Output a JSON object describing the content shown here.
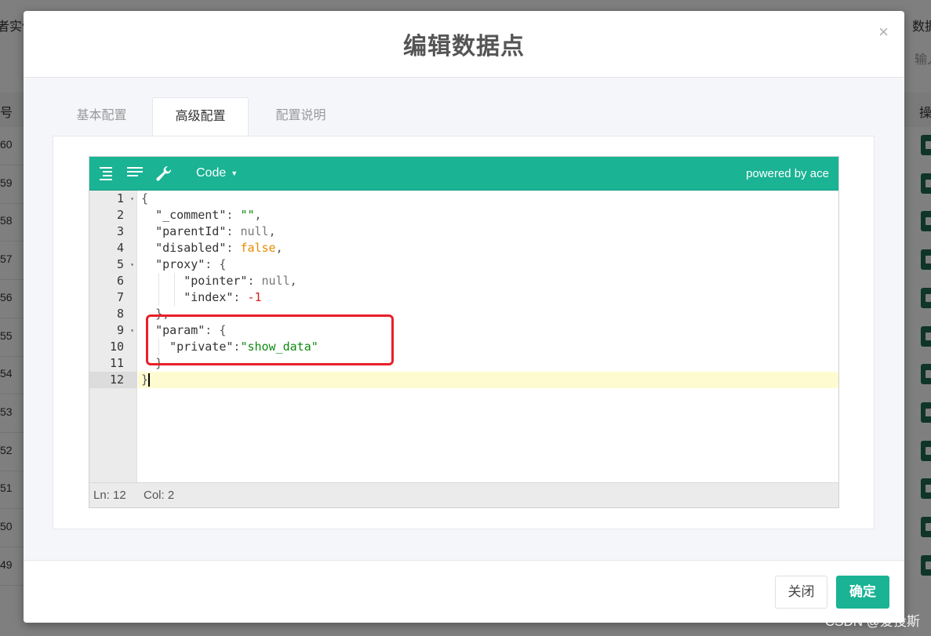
{
  "background": {
    "header_left": "者实例",
    "header_right": "数据",
    "input_right": "输入",
    "col_left": "号",
    "col_right": "操",
    "row_ids": [
      "60",
      "59",
      "58",
      "57",
      "56",
      "55",
      "54",
      "53",
      "52",
      "51",
      "50",
      "49"
    ]
  },
  "modal": {
    "title": "编辑数据点",
    "close_glyph": "×",
    "tabs": [
      {
        "label": "基本配置"
      },
      {
        "label": "高级配置"
      },
      {
        "label": "配置说明"
      }
    ],
    "active_tab": "高级配置",
    "editor": {
      "mode_label": "Code",
      "powered_by": "powered by ace",
      "line_numbers": [
        "1",
        "2",
        "3",
        "4",
        "5",
        "6",
        "7",
        "8",
        "9",
        "10",
        "11",
        "12"
      ],
      "fold_lines": [
        1,
        5,
        9
      ],
      "code": {
        "l1_brace": "{",
        "l2_key": "\"_comment\"",
        "l2_val": "\"\"",
        "l3_key": "\"parentId\"",
        "l3_val": "null",
        "l4_key": "\"disabled\"",
        "l4_val": "false",
        "l5_key": "\"proxy\"",
        "l6_key": "\"pointer\"",
        "l6_val": "null",
        "l7_key": "\"index\"",
        "l7_val": "-1",
        "l8_close": "},",
        "l9_key": "\"param\"",
        "l10_key": "\"private\"",
        "l10_val": "\"show_data\"",
        "l11_close": "}",
        "l12_close": "}"
      },
      "status": {
        "ln": "Ln: 12",
        "col": "Col: 2"
      }
    },
    "buttons": {
      "close": "关闭",
      "ok": "确定"
    }
  },
  "watermark": "CSDN @爱投斯",
  "colors": {
    "accent": "#1ab394",
    "highlight": "#e8202a"
  }
}
